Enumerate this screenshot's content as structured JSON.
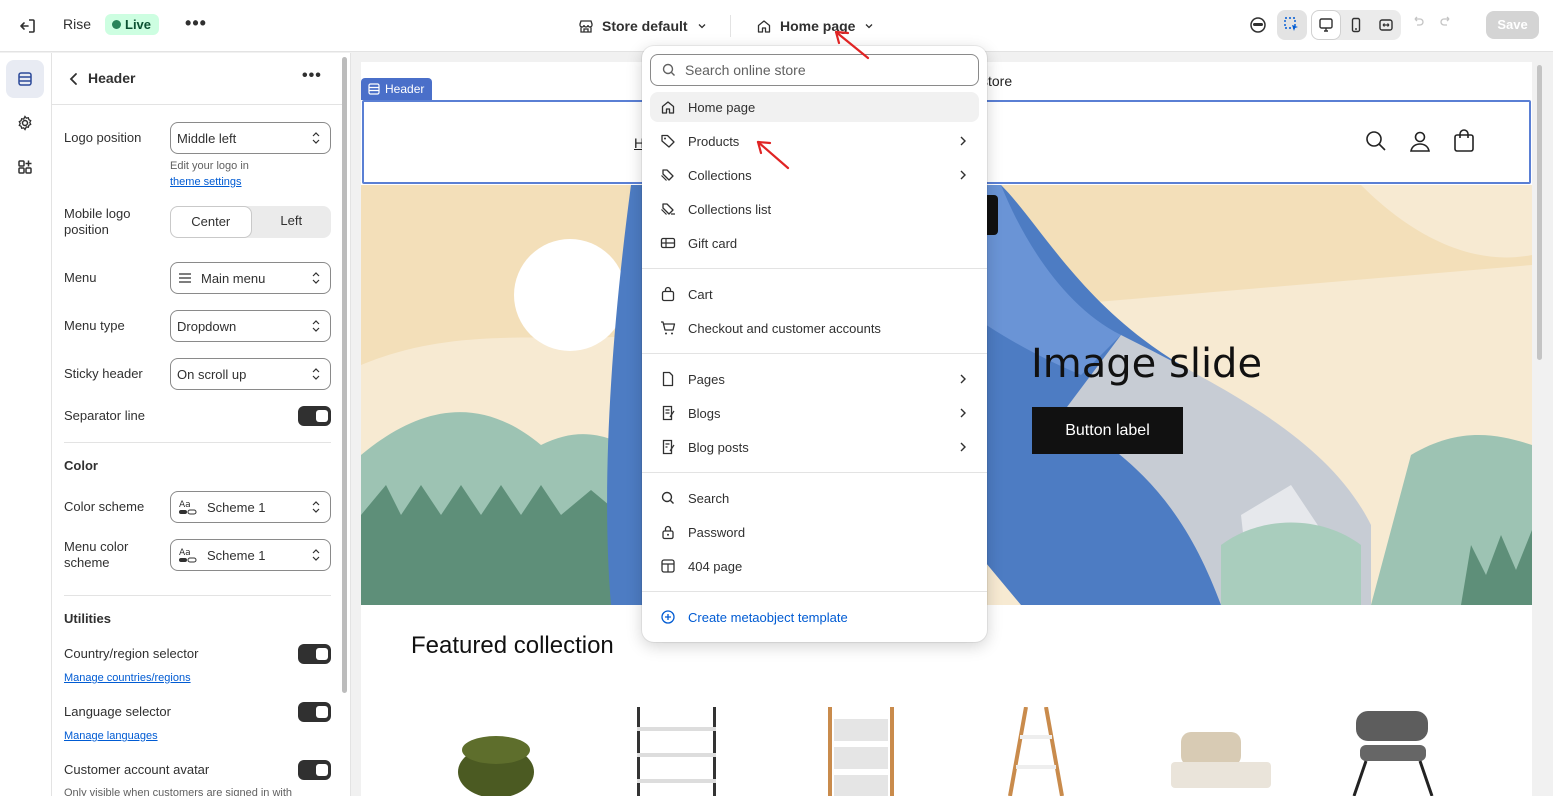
{
  "topbar": {
    "theme_name": "Rise",
    "live_badge": "Live",
    "store_selector": "Store default",
    "page_selector": "Home page",
    "save_label": "Save"
  },
  "panel": {
    "title": "Header",
    "logo_position": {
      "label": "Logo position",
      "value": "Middle left",
      "hint": "Edit your logo in",
      "hint_link": "theme settings"
    },
    "mobile_logo_position": {
      "label_line1": "Mobile logo",
      "label_line2": "position",
      "options": [
        "Center",
        "Left"
      ],
      "selected": "Center"
    },
    "menu": {
      "label": "Menu",
      "value": "Main menu"
    },
    "menu_type": {
      "label": "Menu type",
      "value": "Dropdown"
    },
    "sticky_header": {
      "label": "Sticky header",
      "value": "On scroll up"
    },
    "separator_line": {
      "label": "Separator line"
    },
    "color_heading": "Color",
    "color_scheme": {
      "label": "Color scheme",
      "value": "Scheme 1"
    },
    "menu_color_scheme": {
      "label_line1": "Menu color",
      "label_line2": "scheme",
      "value": "Scheme 1"
    },
    "utilities_heading": "Utilities",
    "country_selector": {
      "label": "Country/region selector",
      "link": "Manage countries/regions"
    },
    "language_selector": {
      "label": "Language selector",
      "link": "Manage languages"
    },
    "customer_avatar": {
      "label": "Customer account avatar",
      "hint": "Only visible when customers are signed in with"
    }
  },
  "preview": {
    "announcement": "store",
    "header_tag": "Header",
    "nav_first": "H",
    "hero_title": "Image slide",
    "hero_button": "Button label",
    "featured_title": "Featured collection"
  },
  "dropdown": {
    "search_placeholder": "Search online store",
    "items": [
      {
        "label": "Home page",
        "icon": "home-icon"
      },
      {
        "label": "Products",
        "icon": "tag-icon"
      },
      {
        "label": "Collections",
        "icon": "collection-icon"
      },
      {
        "label": "Collections list",
        "icon": "collections-list-icon"
      },
      {
        "label": "Gift card",
        "icon": "gift-card-icon"
      },
      {
        "label": "Cart",
        "icon": "bag-icon"
      },
      {
        "label": "Checkout and customer accounts",
        "icon": "cart-icon"
      },
      {
        "label": "Pages",
        "icon": "page-icon"
      },
      {
        "label": "Blogs",
        "icon": "blog-icon"
      },
      {
        "label": "Blog posts",
        "icon": "blog-post-icon"
      },
      {
        "label": "Search",
        "icon": "search-icon"
      },
      {
        "label": "Password",
        "icon": "lock-icon"
      },
      {
        "label": "404 page",
        "icon": "404-icon"
      }
    ],
    "create_label": "Create metaobject template"
  },
  "colors": {
    "accent": "#005bd3",
    "selection_outline": "#5a7fd4",
    "live_bg": "#cdfee1"
  }
}
